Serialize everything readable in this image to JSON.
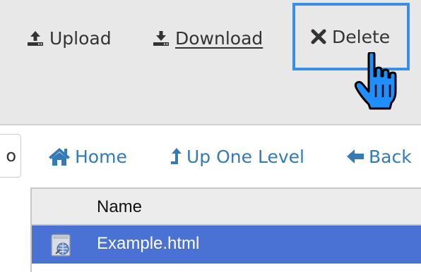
{
  "toolbar": {
    "upload_label": "Upload",
    "download_label": "Download",
    "delete_label": "Delete"
  },
  "search": {
    "partial_text": "o"
  },
  "nav": {
    "home_label": "Home",
    "up_label": "Up One Level",
    "back_label": "Back"
  },
  "table": {
    "columns": [
      "Name"
    ],
    "rows": [
      {
        "name": "Example.html",
        "icon": "html-file-icon",
        "selected": true
      }
    ]
  },
  "icons": {
    "upload": "upload-icon",
    "download": "download-icon",
    "delete": "times-icon",
    "home": "home-icon",
    "up": "level-up-icon",
    "back": "arrow-left-icon",
    "cursor": "hand-pointer-cursor"
  },
  "colors": {
    "toolbar_bg": "#e8e8e8",
    "link_blue": "#337ab7",
    "highlight_border": "#3b8ee6",
    "selected_row": "#4a72d4"
  }
}
